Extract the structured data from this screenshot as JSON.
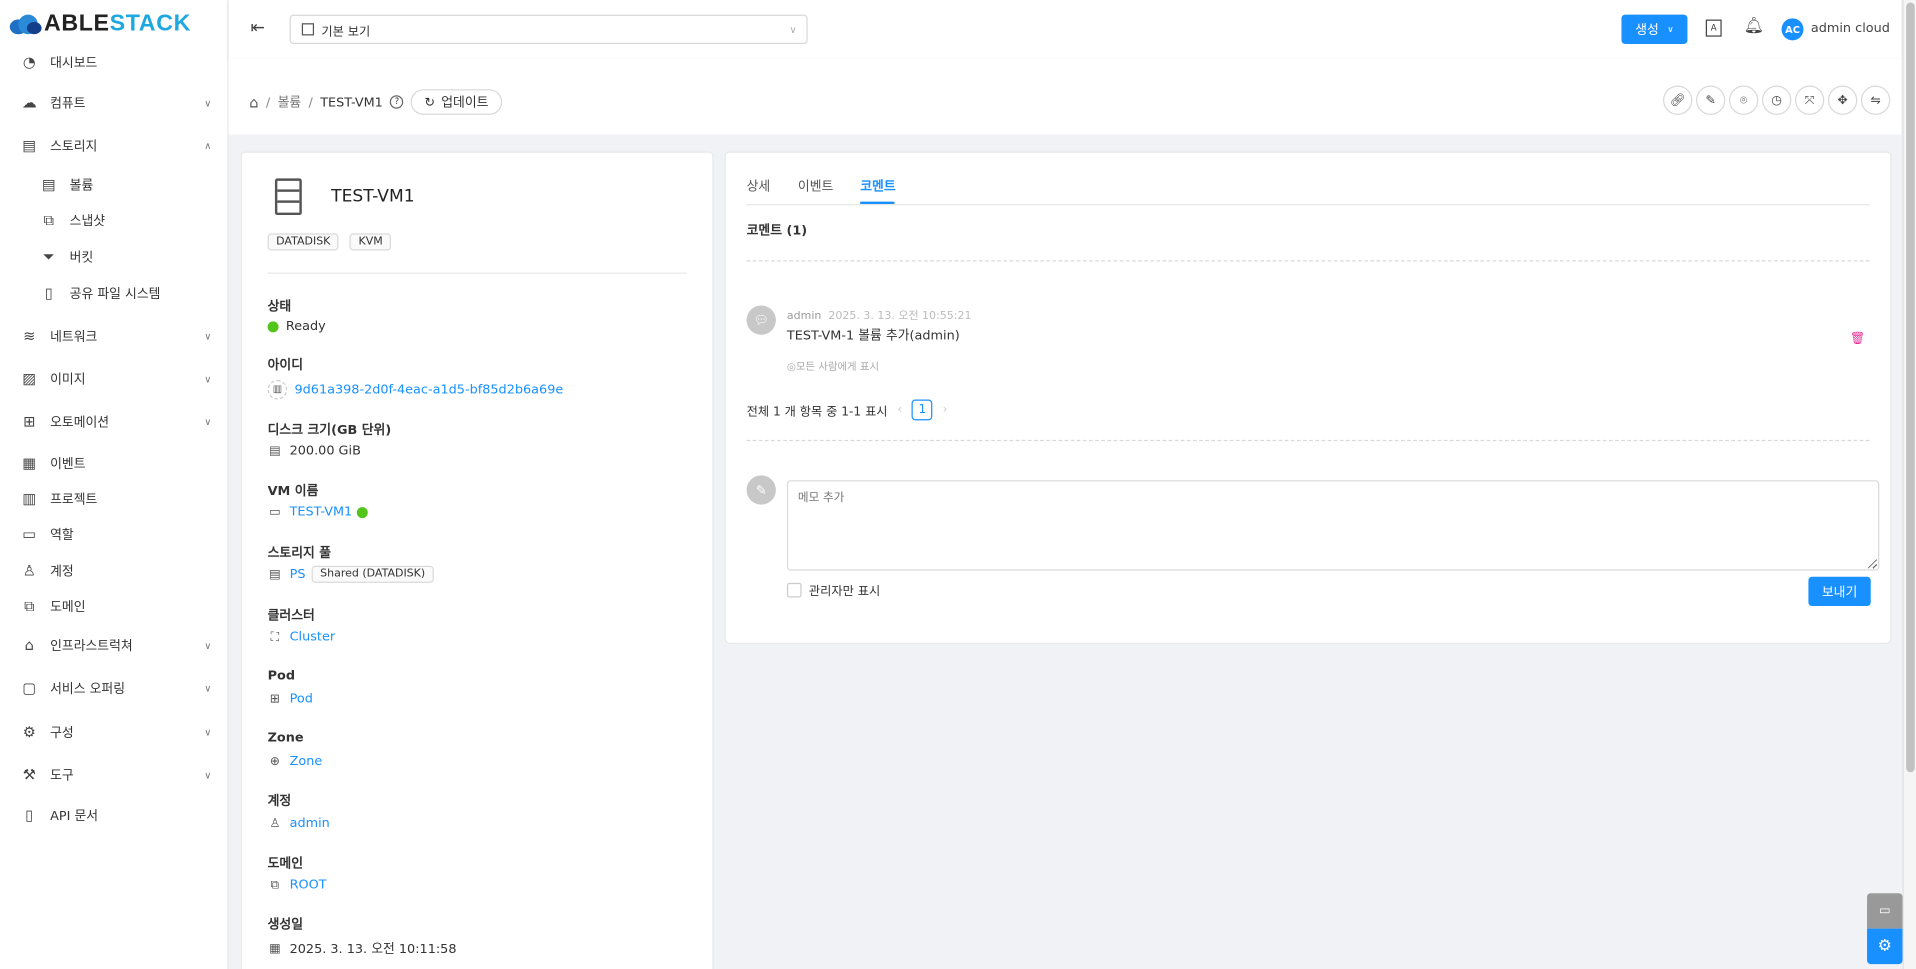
{
  "brand": {
    "logo_text_dark": "ABLE",
    "logo_text_light": "STACK"
  },
  "sidebar": {
    "items": [
      {
        "label": "대시보드",
        "icon": "dashboard-icon"
      },
      {
        "label": "컴퓨트",
        "icon": "cloud-icon",
        "chevron": "down"
      },
      {
        "label": "스토리지",
        "icon": "storage-icon",
        "chevron": "up"
      },
      {
        "label": "볼륨",
        "icon": "volume-icon",
        "sub": true
      },
      {
        "label": "스냅샷",
        "icon": "snapshot-icon",
        "sub": true
      },
      {
        "label": "버킷",
        "icon": "bucket-icon",
        "sub": true
      },
      {
        "label": "공유 파일 시스템",
        "icon": "file-icon",
        "sub": true
      },
      {
        "label": "네트워크",
        "icon": "wifi-icon",
        "chevron": "down"
      },
      {
        "label": "이미지",
        "icon": "image-icon",
        "chevron": "down"
      },
      {
        "label": "오토메이션",
        "icon": "automation-icon",
        "chevron": "down"
      },
      {
        "label": "이벤트",
        "icon": "event-icon"
      },
      {
        "label": "프로젝트",
        "icon": "project-icon"
      },
      {
        "label": "역할",
        "icon": "role-icon"
      },
      {
        "label": "계정",
        "icon": "account-icon"
      },
      {
        "label": "도메인",
        "icon": "domain-icon"
      },
      {
        "label": "인프라스트럭쳐",
        "icon": "bank-icon",
        "chevron": "down"
      },
      {
        "label": "서비스 오퍼링",
        "icon": "shopping-icon",
        "chevron": "down"
      },
      {
        "label": "구성",
        "icon": "gear-icon",
        "chevron": "down"
      },
      {
        "label": "도구",
        "icon": "tool-icon",
        "chevron": "down"
      },
      {
        "label": "API 문서",
        "icon": "book-icon"
      }
    ]
  },
  "header": {
    "view_select": "기본 보기",
    "create_label": "생성",
    "user_initials": "AC",
    "user_name": "admin cloud"
  },
  "breadcrumb": {
    "level1": "볼륨",
    "current": "TEST-VM1",
    "refresh_label": "업데이트"
  },
  "actions": [
    "link-icon",
    "edit-icon",
    "camera-icon",
    "clock-icon",
    "resize-icon",
    "move-icon",
    "swap-icon"
  ],
  "volume": {
    "name": "TEST-VM1",
    "tags": [
      "DATADISK",
      "KVM"
    ],
    "fields": {
      "status_label": "상태",
      "status": "Ready",
      "id_label": "아이디",
      "id": "9d61a398-2d0f-4eac-a1d5-bf85d2b6a69e",
      "size_label": "디스크 크기(GB 단위)",
      "size": "200.00 GiB",
      "vm_label": "VM 이름",
      "vm": "TEST-VM1",
      "pool_label": "스토리지 풀",
      "pool": "PS",
      "pool_tag": "Shared (DATADISK)",
      "cluster_label": "클러스터",
      "cluster": "Cluster",
      "pod_label": "Pod",
      "pod": "Pod",
      "zone_label": "Zone",
      "zone": "Zone",
      "account_label": "계정",
      "account": "admin",
      "domain_label": "도메인",
      "domain": "ROOT",
      "created_label": "생성일",
      "created": "2025. 3. 13. 오전 10:11:58"
    }
  },
  "tabs": [
    {
      "label": "상세"
    },
    {
      "label": "이벤트"
    },
    {
      "label": "코멘트",
      "active": true
    }
  ],
  "comments": {
    "title": "코멘트 (1)",
    "items": [
      {
        "author": "admin",
        "time": "2025. 3. 13. 오전 10:55:21",
        "text": "TEST-VM-1 볼륨 추가(admin)",
        "visibility": "모든 사람에게 표시"
      }
    ],
    "pagination_text": "전체 1 개 항목 중 1-1 표시",
    "current_page": "1",
    "placeholder": "메모 추가",
    "admin_only_label": "관리자만 표시",
    "send_label": "보내기"
  },
  "colors": {
    "primary": "#1890ff",
    "success": "#52c41a",
    "danger": "#eb2f96"
  }
}
